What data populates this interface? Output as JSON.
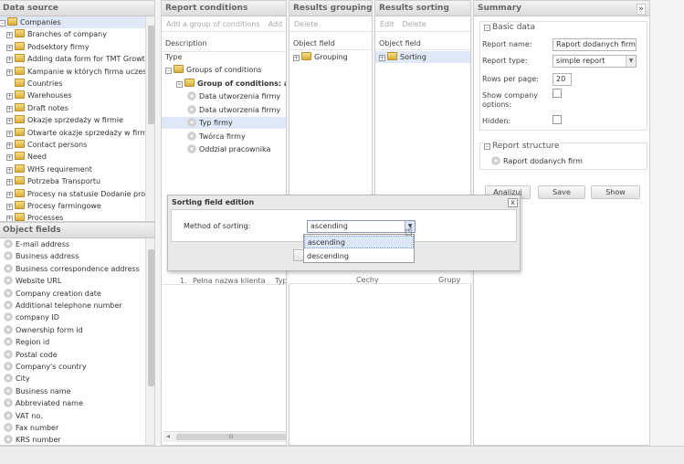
{
  "data_source": {
    "title": "Data source",
    "items": [
      "Companies",
      "Branches of company",
      "Podsektory firmy",
      "Adding data form for TMT Growth",
      "Kampanie w których firma uczest",
      "Countries",
      "Warehouses",
      "Draft notes",
      "Okazje sprzedaży w firmie",
      "Otwarte okazje sprzedaży w firmie",
      "Contact persons",
      "Need",
      "WHS requirement",
      "Potrzeba Transportu",
      "Procesy na statusie Dodanie proc",
      "Procesy farmingowe",
      "Processes"
    ]
  },
  "object_fields": {
    "title": "Object fields",
    "items": [
      "E-mail address",
      "Business address",
      "Business correspondence address",
      "Website URL",
      "Company creation date",
      "Additional telephone number",
      "company ID",
      "Ownership form id",
      "Region id",
      "Postal code",
      "Company's country",
      "City",
      "Business name",
      "Abbreviated name",
      "VAT no.",
      "Fax number",
      "KRS number"
    ]
  },
  "report_conditions": {
    "title": "Report conditions",
    "toolbar": [
      "Add a group of conditions",
      "Add"
    ],
    "description_header": "Description",
    "type_header": "Type",
    "tree": [
      "Groups of conditions",
      "Group of conditions: and",
      "Data utworzenia firmy",
      "Data utworzenia firmy",
      "Typ firmy",
      "Twórca firmy",
      "Oddział pracownika"
    ],
    "columns": [
      "1.",
      "Pełna nazwa klienta",
      "Typ",
      "Cechy",
      "Grupy"
    ],
    "scroll_thumb": "III"
  },
  "results_grouping": {
    "title": "Results grouping",
    "toolbar": [
      "Delete"
    ],
    "header": "Object field",
    "items": [
      "Grouping"
    ]
  },
  "results_sorting": {
    "title": "Results sorting",
    "toolbar": [
      "Edit",
      "Delete"
    ],
    "header": "Object field",
    "items": [
      "Sorting"
    ]
  },
  "summary": {
    "title": "Summary",
    "collapse": "»",
    "basic_data": "Basic data",
    "report_name_label": "Report name:",
    "report_name_value": "Raport dodanych firm",
    "report_type_label": "Report type:",
    "report_type_value": "simple report",
    "rows_label": "Rows per page:",
    "rows_value": "20",
    "show_company_label_1": "Show company",
    "show_company_label_2": "options:",
    "hidden_label": "Hidden:",
    "structure_title": "Report structure",
    "structure_item": "Raport dodanych firm",
    "buttons": [
      "Analizuj",
      "Save",
      "Show"
    ]
  },
  "dialog": {
    "title": "Sorting field edition",
    "close": "x",
    "method_label": "Method of sorting:",
    "method_value": "ascending",
    "options": [
      "ascending",
      "descending"
    ]
  }
}
